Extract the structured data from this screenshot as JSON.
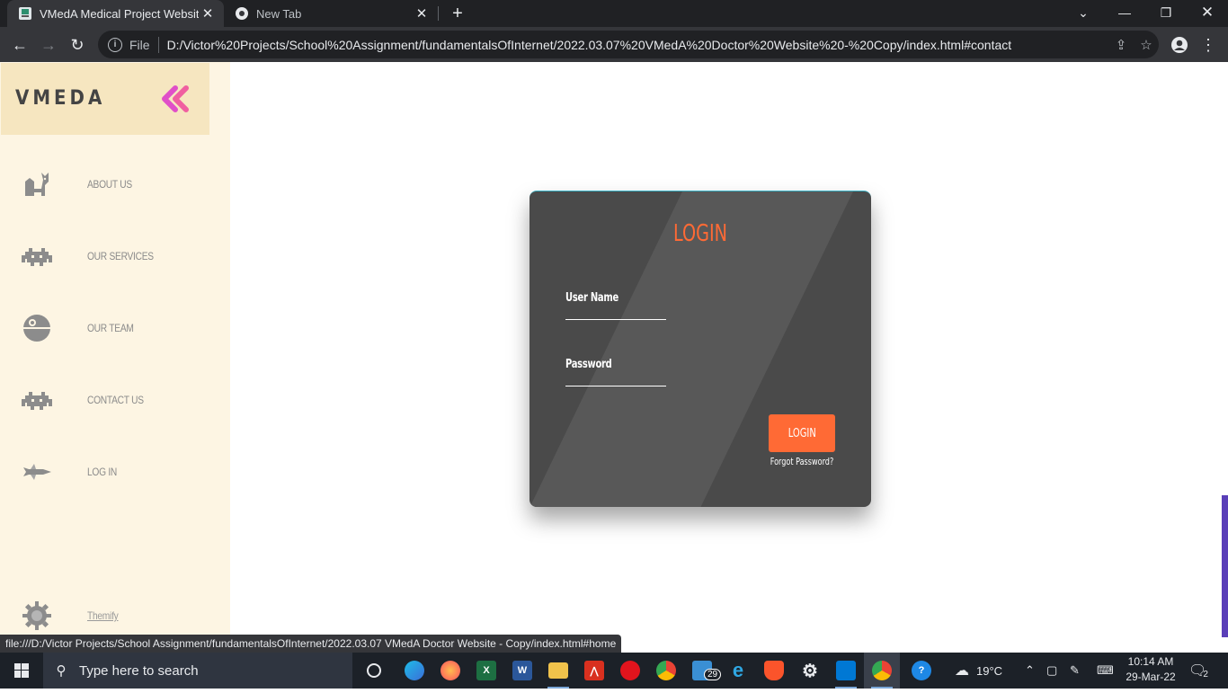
{
  "browser": {
    "tabs": [
      {
        "title": "VMedA Medical Project Website",
        "active": true
      },
      {
        "title": "New Tab",
        "active": false
      }
    ],
    "new_tab_glyph": "+",
    "omnibox": {
      "scheme_label": "File",
      "url": "D:/Victor%20Projects/School%20Assignment/fundamentalsOfInternet/2022.03.07%20VMedA%20Doctor%20Website%20-%20Copy/index.html#contact"
    },
    "status_url": "file:///D:/Victor Projects/School Assignment/fundamentalsOfInternet/2022.03.07 VMedA Doctor Website - Copy/index.html#home"
  },
  "sidebar": {
    "brand": "VMEDA",
    "items": [
      {
        "label": "ABOUT US",
        "icon": "cat-icon"
      },
      {
        "label": "OUR SERVICES",
        "icon": "space-invader-icon"
      },
      {
        "label": "OUR TEAM",
        "icon": "death-star-icon"
      },
      {
        "label": "CONTACT US",
        "icon": "space-invader-icon"
      },
      {
        "label": "LOG IN",
        "icon": "spaceship-icon"
      }
    ],
    "footer": {
      "label": "Themify",
      "icon": "gear-icon"
    }
  },
  "login": {
    "title": "LOGIN",
    "username_label": "User Name",
    "password_label": "Password",
    "button": "LOGIN",
    "forgot": "Forgot Password?"
  },
  "taskbar": {
    "search_placeholder": "Type here to search",
    "weather": "19°C",
    "time": "10:14 AM",
    "date": "29-Mar-22",
    "notification_count": "2",
    "badge_29": "29"
  },
  "colors": {
    "accent_orange": "#ff6a35",
    "sidebar_bg": "#fdf5e3",
    "brand_bg": "#f6e6c0",
    "card_bg": "#4a4a4a",
    "collapse_pink": "#e04fc8"
  }
}
